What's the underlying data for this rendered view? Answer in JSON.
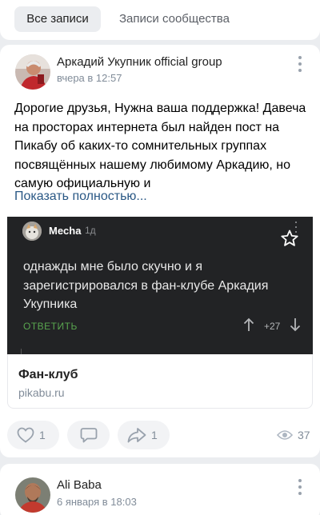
{
  "tabs": {
    "all_posts": "Все записи",
    "community_posts": "Записи сообщества"
  },
  "post": {
    "author": "Аркадий Укупник official group",
    "time": "вчера в 12:57",
    "text": "Дорогие друзья, Нужна ваша поддержка! Давеча на просторах интернета был найден пост на Пикабу об каких-то сомнительных группах посвящённых нашему любимому Аркадию, но самую официальную и",
    "show_more": "Показать полностью...",
    "embed": {
      "comment_author": "Mecha",
      "comment_time": "1д",
      "comment_text": "однажды мне было скучно и я зарегистрировался в фан-клубе Аркадия Укупника",
      "reply_label": "ОТВЕТИТЬ",
      "score": "+27"
    },
    "link": {
      "title": "Фан-клуб",
      "url": "pikabu.ru"
    },
    "actions": {
      "likes": "1",
      "shares": "1",
      "views": "37"
    }
  },
  "next_post": {
    "author": "Ali Baba",
    "time": "6 января в 18:03"
  },
  "icons": {
    "kebab": "kebab-menu-icon",
    "star": "star-icon",
    "up": "arrow-up-icon",
    "down": "arrow-down-icon",
    "like": "heart-icon",
    "comment": "comment-icon",
    "share": "share-icon",
    "views": "eye-icon"
  },
  "colors": {
    "link": "#2a5885",
    "reply": "#59a54f",
    "embed_bg": "#222325"
  }
}
